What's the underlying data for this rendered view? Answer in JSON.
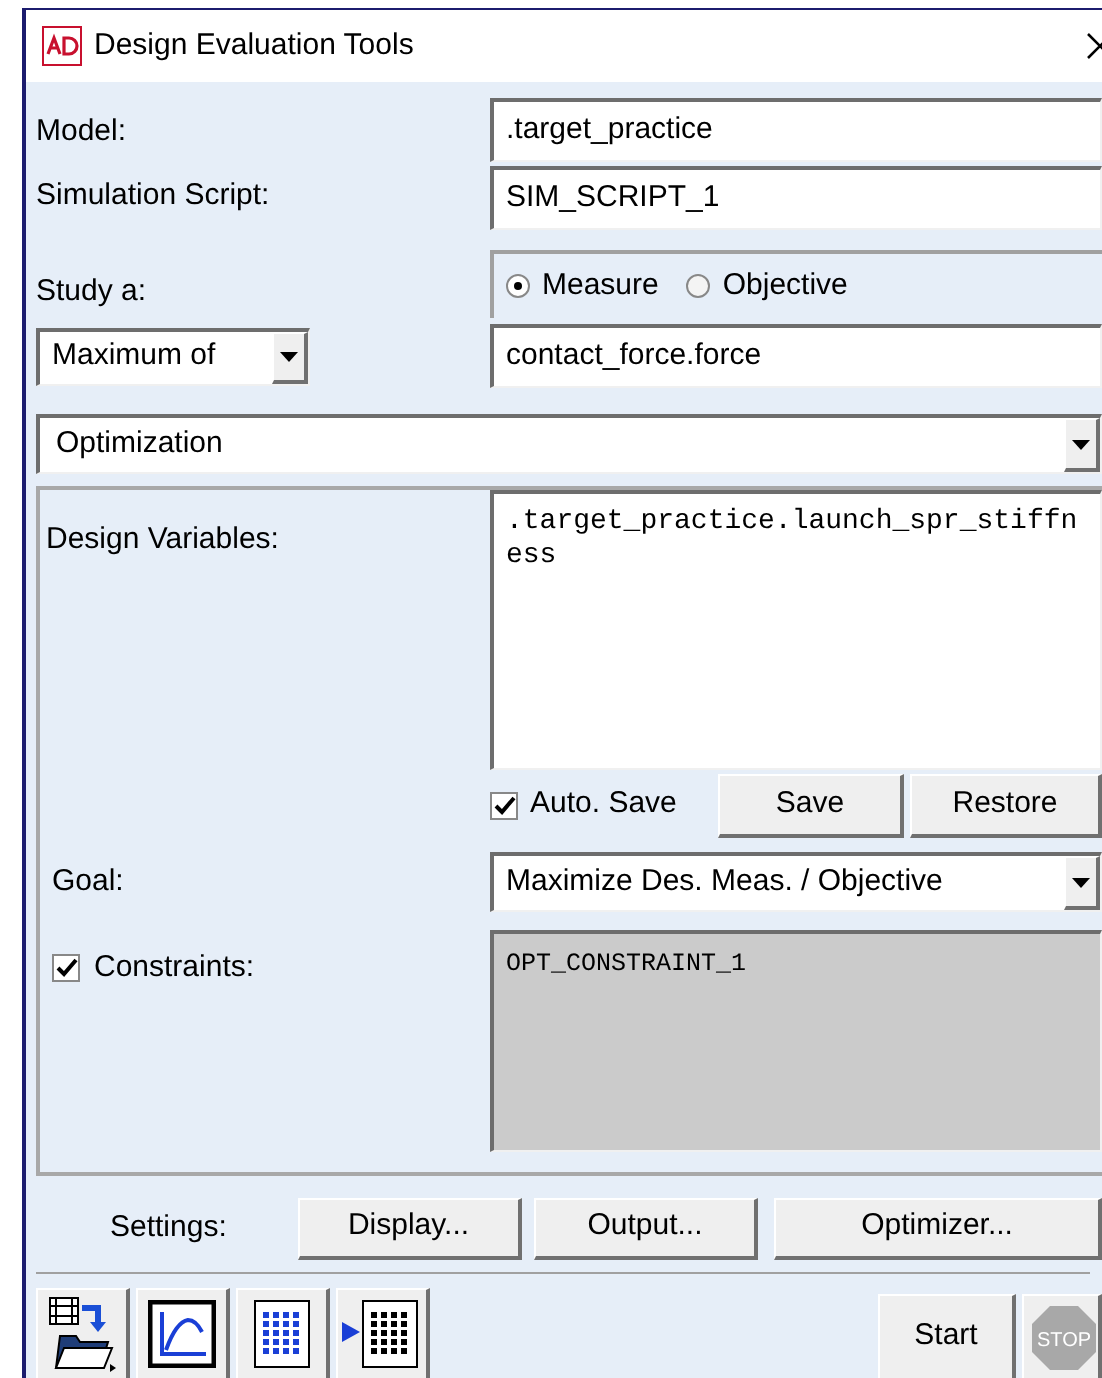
{
  "window": {
    "title": "Design Evaluation Tools"
  },
  "model": {
    "label": "Model:",
    "value": ".target_practice"
  },
  "simulation_script": {
    "label": "Simulation Script:",
    "value": "SIM_SCRIPT_1"
  },
  "study": {
    "label": "Study a:",
    "options": [
      {
        "label": "Measure",
        "selected": true
      },
      {
        "label": "Objective",
        "selected": false
      }
    ]
  },
  "measure": {
    "dropdown": "Maximum of",
    "value": "contact_force.force"
  },
  "mode_dropdown": "Optimization",
  "design_variables": {
    "label": "Design Variables:",
    "value": ".target_practice.launch_spr_stiffness"
  },
  "auto_save": {
    "label": "Auto. Save",
    "checked": true
  },
  "variable_buttons": [
    "Save",
    "Restore"
  ],
  "goal": {
    "label": "Goal:",
    "value": "Maximize Des. Meas. / Objective"
  },
  "constraints": {
    "label": "Constraints:",
    "checked": true,
    "value": "OPT_CONSTRAINT_1"
  },
  "settings": {
    "label": "Settings:",
    "buttons": [
      "Display...",
      "Output...",
      "Optimizer..."
    ]
  },
  "start_button": "Start",
  "stop_button": {
    "label": "STOP",
    "disabled": true
  }
}
